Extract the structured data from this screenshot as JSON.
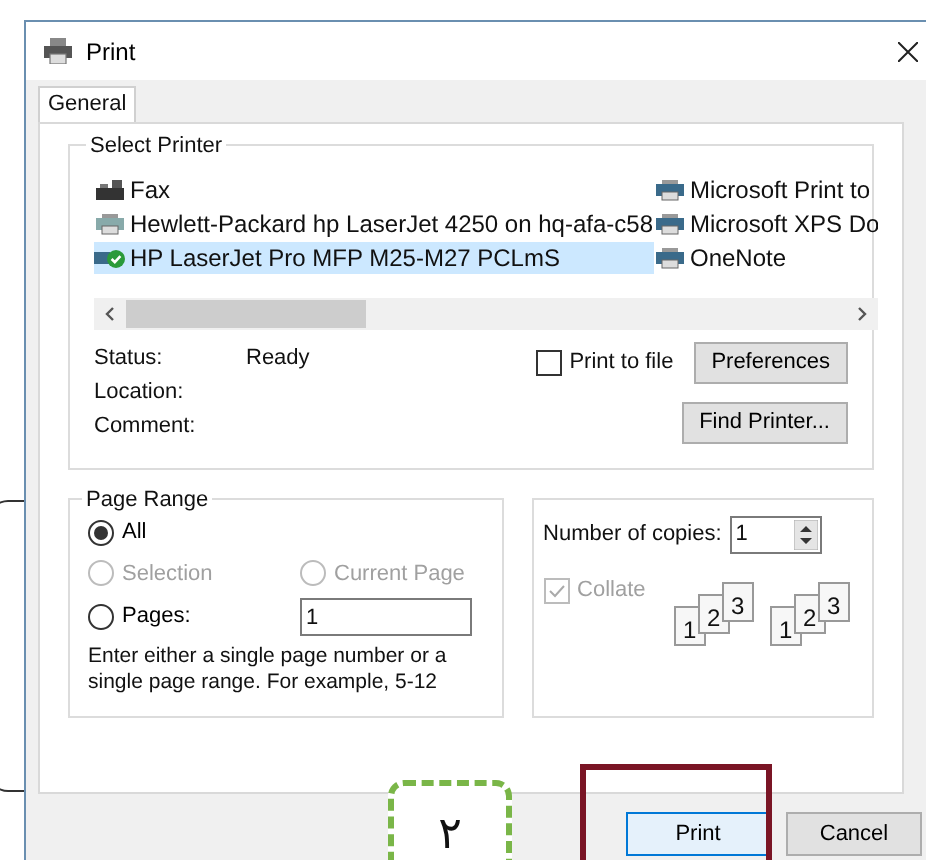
{
  "window": {
    "title": "Print"
  },
  "tabs": [
    {
      "label": "General",
      "selected": true
    }
  ],
  "select_printer": {
    "title": "Select Printer",
    "printers": [
      {
        "name": "Fax",
        "kind": "fax",
        "selected": false
      },
      {
        "name": "Hewlett-Packard hp LaserJet 4250 on hq-afa-c58",
        "kind": "network",
        "selected": false
      },
      {
        "name": "HP LaserJet Pro MFP M25-M27 PCLmS",
        "kind": "default",
        "selected": true
      },
      {
        "name": "Microsoft Print to",
        "kind": "printer",
        "selected": false
      },
      {
        "name": "Microsoft XPS Do",
        "kind": "printer",
        "selected": false
      },
      {
        "name": "OneNote",
        "kind": "printer",
        "selected": false
      }
    ],
    "info": [
      {
        "label": "Status:",
        "value": "Ready"
      },
      {
        "label": "Location:"
      },
      {
        "label": "Comment:"
      }
    ],
    "print_to_file": {
      "label": "Print to file",
      "checked": false
    },
    "buttons": [
      "Preferences",
      "Find Printer..."
    ]
  },
  "page_range": {
    "title": "Page Range",
    "options": [
      {
        "label": "All",
        "selected": true,
        "disabled": false
      },
      {
        "label": "Selection",
        "selected": false,
        "disabled": true
      },
      {
        "label": "Current Page",
        "selected": false,
        "disabled": true
      },
      {
        "label": "Pages:",
        "selected": false,
        "disabled": false
      }
    ],
    "pages_value": "1",
    "hint": "Enter either a single page number or a single page range.  For example, 5-12"
  },
  "copies": {
    "label": "Number of copies:",
    "value": "1",
    "collate": {
      "label": "Collate",
      "checked": true,
      "disabled": true
    },
    "stacks": [
      [
        "1",
        "2",
        "3"
      ],
      [
        "1",
        "2",
        "3"
      ]
    ]
  },
  "buttons": [
    {
      "label": "Print",
      "kind": "default"
    },
    {
      "label": "Cancel",
      "kind": "normal"
    }
  ],
  "annotations": [
    {
      "label": "٢"
    }
  ]
}
